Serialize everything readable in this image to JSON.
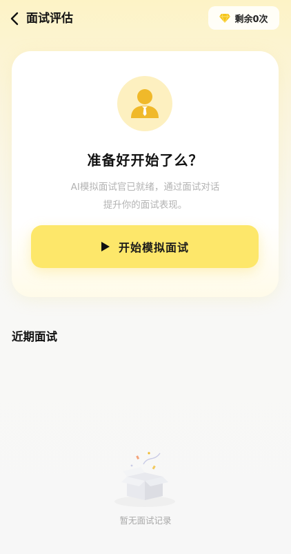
{
  "header": {
    "title": "面试评估",
    "remaining_label": "剩余0次"
  },
  "hero": {
    "title": "准备好开始了么？",
    "description_line1": "AI模拟面试官已就绪，通过面试对话",
    "description_line2": "提升你的面试表现。",
    "start_button_label": "开始模拟面试"
  },
  "recent": {
    "section_title": "近期面试",
    "empty_text": "暂无面试记录"
  },
  "icons": {
    "back": "chevron-left-icon",
    "diamond": "diamond-icon",
    "avatar": "person-icon",
    "play": "play-icon",
    "empty": "empty-box-icon"
  },
  "colors": {
    "accent": "#fde76a",
    "avatar_bg": "#fdf0c0",
    "avatar_figure": "#f0b92a",
    "diamond": "#f5c518"
  }
}
